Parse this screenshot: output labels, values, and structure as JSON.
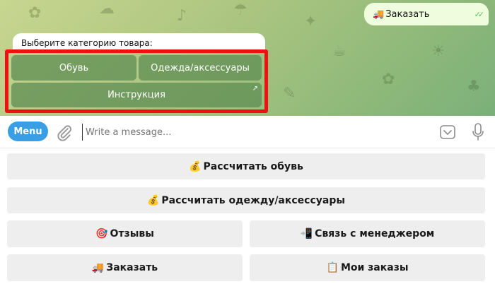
{
  "chat": {
    "outgoing_message": {
      "emoji": "🚚",
      "text": "Заказать",
      "status": "✓✓"
    },
    "incoming_message": {
      "text": "Выберите категорию товара:"
    },
    "inline_keyboard": [
      {
        "label": "Обувь"
      },
      {
        "label": "Одежда/аксессуары"
      },
      {
        "label": "Инструкция",
        "arrow": "↗"
      }
    ]
  },
  "input_bar": {
    "menu_label": "Menu",
    "placeholder": "Write a message..."
  },
  "reply_keyboard": [
    {
      "emoji": "💰",
      "label": "Рассчитать обувь"
    },
    {
      "emoji": "💰",
      "label": "Рассчитать одежду/аксессуары"
    },
    {
      "emoji": "🎯",
      "label": "Отзывы"
    },
    {
      "emoji": "📲",
      "label": "Связь с менеджером"
    },
    {
      "emoji": "🚚",
      "label": "Заказать"
    },
    {
      "emoji": "📋",
      "label": "Мои заказы"
    }
  ],
  "colors": {
    "accent": "#3a9ee4",
    "highlight": "#ee1111",
    "inline_button": "#5c8a52"
  }
}
